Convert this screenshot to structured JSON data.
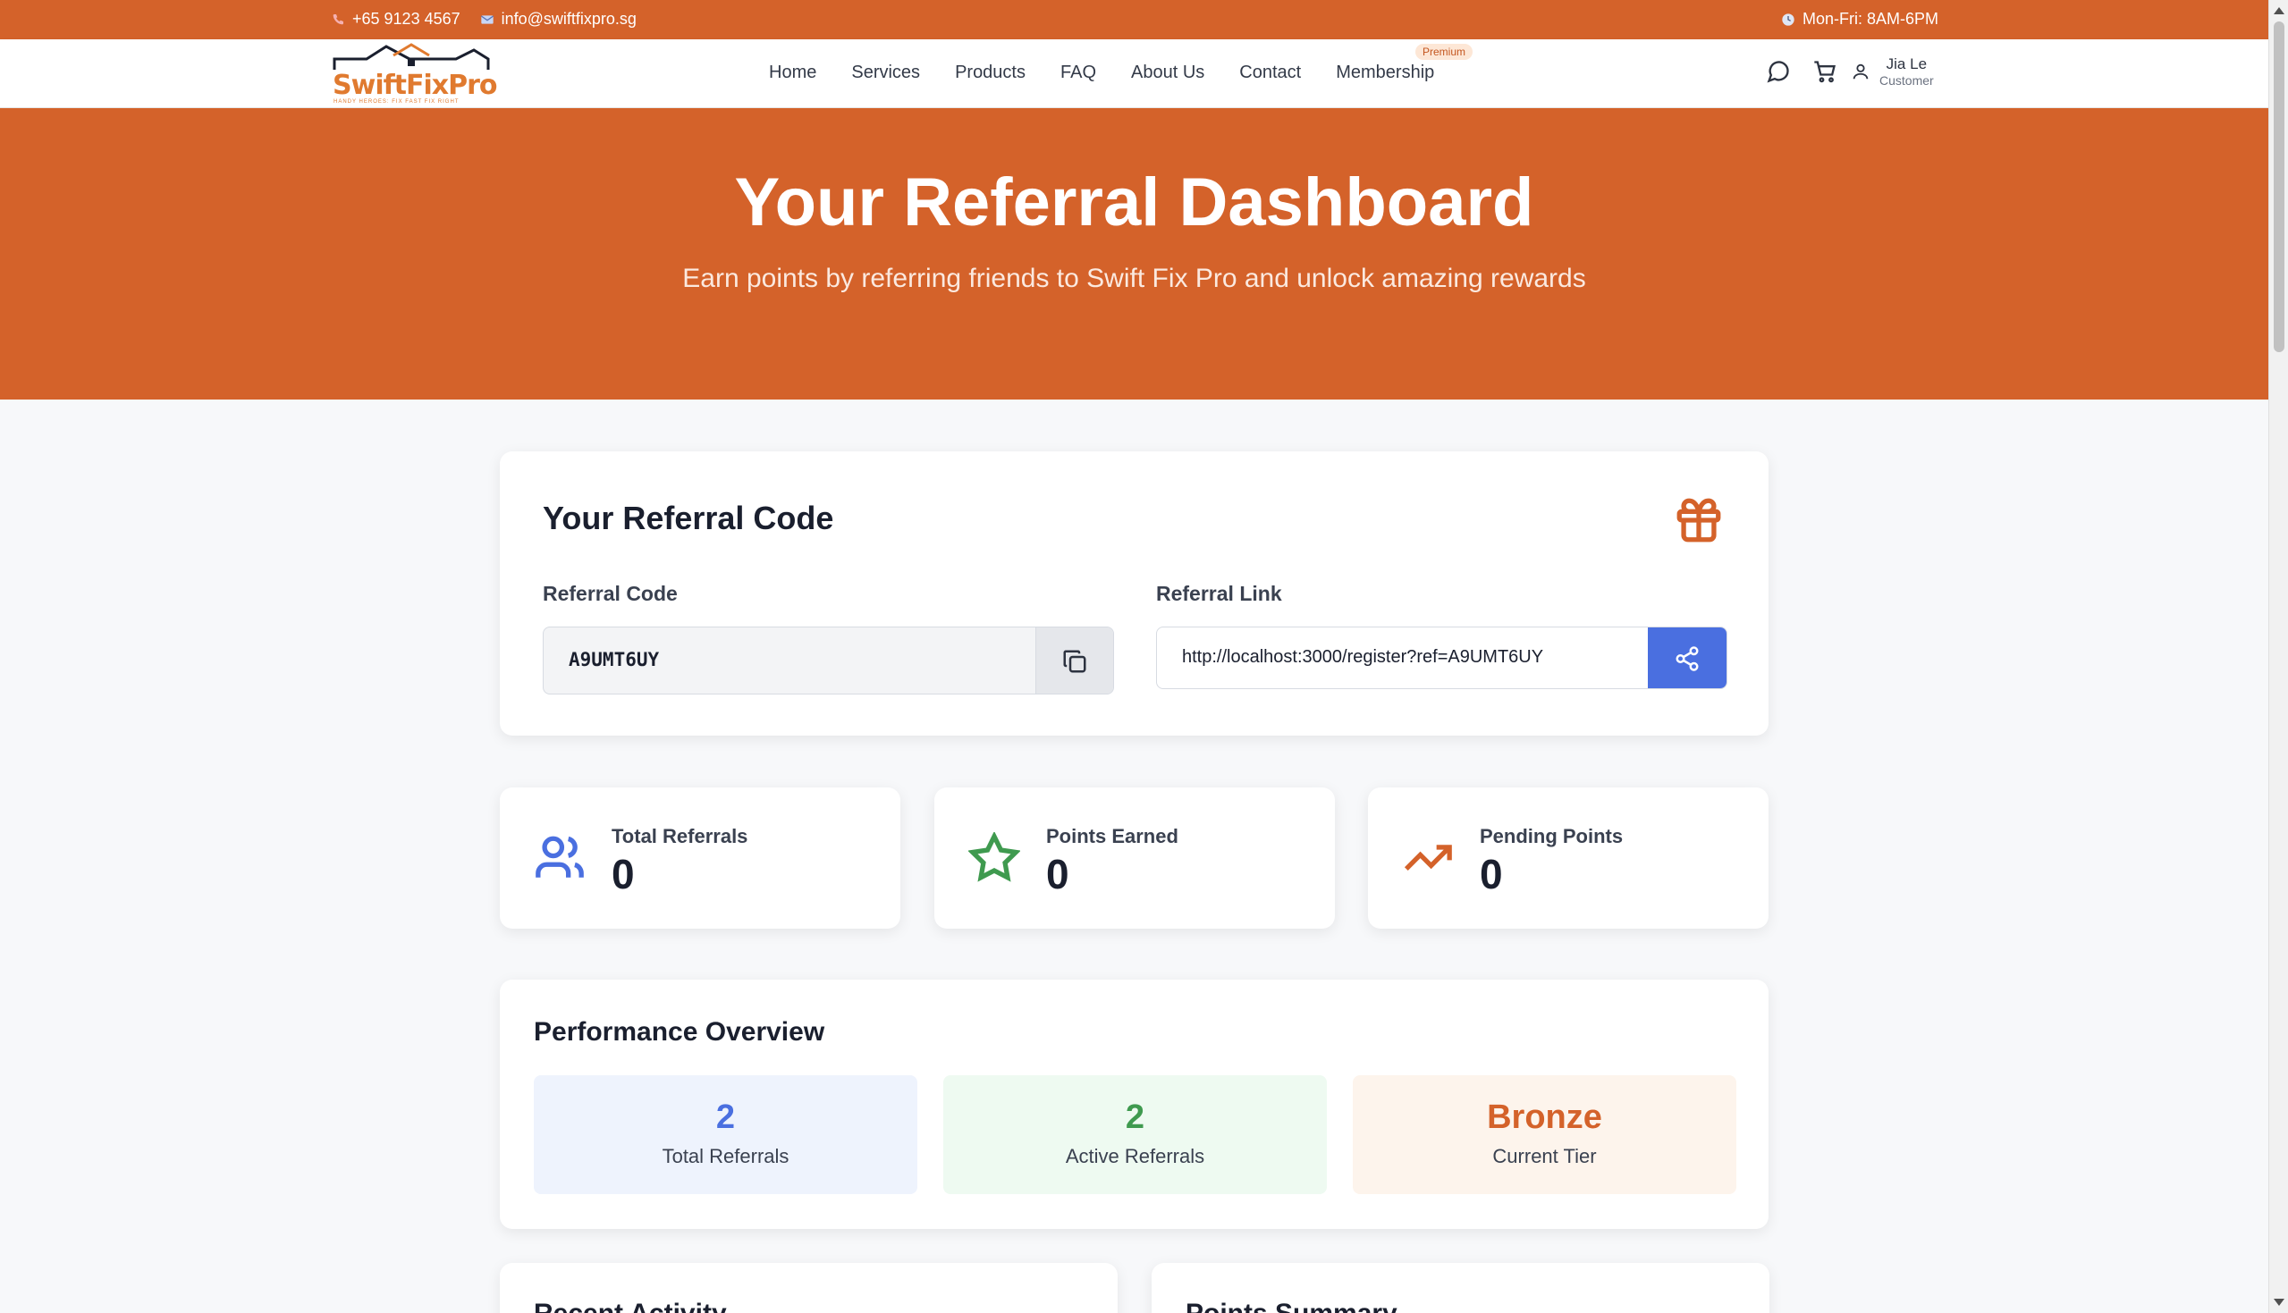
{
  "topbar": {
    "phone": "+65 9123 4567",
    "email": "info@swiftfixpro.sg",
    "hours": "Mon-Fri: 8AM-6PM"
  },
  "brand": {
    "name": "SwiftFixPro",
    "tagline": "HANDY HEROES: FIX FAST FIX RIGHT"
  },
  "nav": {
    "items": [
      "Home",
      "Services",
      "Products",
      "FAQ",
      "About Us",
      "Contact",
      "Membership"
    ],
    "premium_badge": "Premium",
    "user_name": "Jia Le",
    "user_role": "Customer"
  },
  "hero": {
    "title": "Your Referral Dashboard",
    "subtitle": "Earn points by referring friends to Swift Fix Pro and unlock amazing rewards"
  },
  "referral": {
    "heading": "Your Referral Code",
    "code_label": "Referral Code",
    "code": "A9UMT6UY",
    "link_label": "Referral Link",
    "link": "http://localhost:3000/register?ref=A9UMT6UY"
  },
  "stats": [
    {
      "label": "Total Referrals",
      "value": "0",
      "icon": "users-icon",
      "color": "#4a6fe0"
    },
    {
      "label": "Points Earned",
      "value": "0",
      "icon": "star-icon",
      "color": "#3f9a4f"
    },
    {
      "label": "Pending Points",
      "value": "0",
      "icon": "trending-up-icon",
      "color": "#d4622a"
    }
  ],
  "performance": {
    "heading": "Performance Overview",
    "boxes": [
      {
        "value": "2",
        "label": "Total Referrals",
        "color": "#4a6fe0",
        "bg": "#eef3fd"
      },
      {
        "value": "2",
        "label": "Active Referrals",
        "color": "#3f9a4f",
        "bg": "#eefaf1"
      },
      {
        "value": "Bronze",
        "label": "Current Tier",
        "color": "#d4622a",
        "bg": "#fdf4ec"
      }
    ]
  },
  "bottom": {
    "recent_activity": "Recent Activity",
    "points_summary": "Points Summary"
  },
  "colors": {
    "brand_orange": "#d4622a",
    "share_blue": "#4a6fe0"
  }
}
